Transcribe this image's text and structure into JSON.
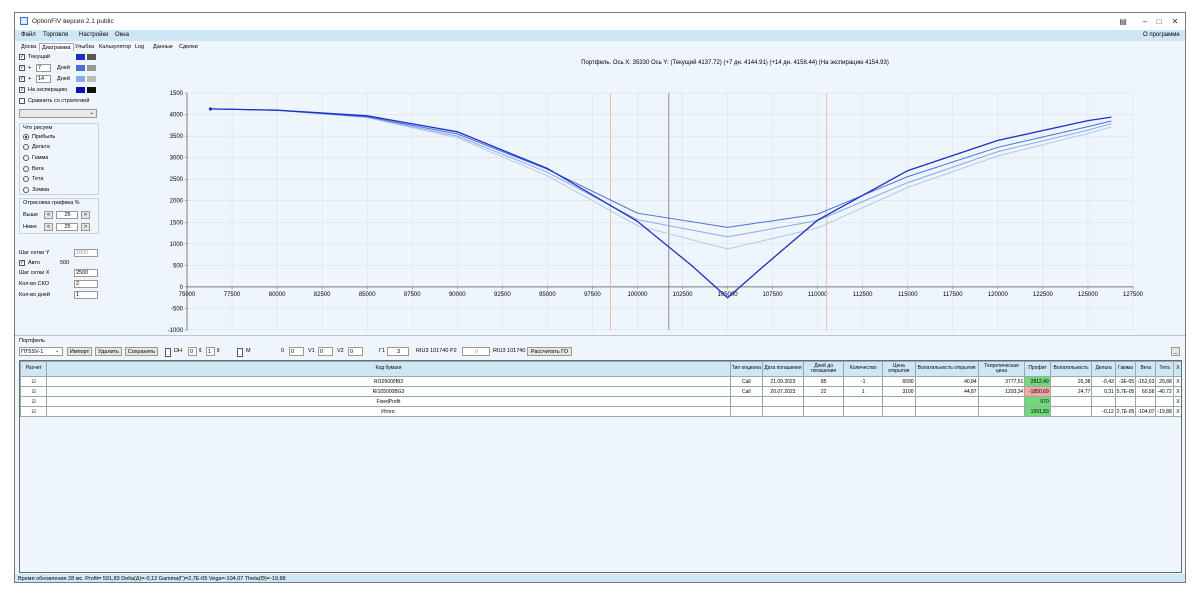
{
  "window": {
    "title": "OptionFIV версия 2.1 public",
    "help_label": "О программе"
  },
  "menu": [
    "Файл",
    "Торговля",
    "Настройки",
    "Окна"
  ],
  "tabs": [
    "Доска",
    "Диаграмма",
    "Улыбка",
    "Калькулятор",
    "Log",
    "Данные",
    "Сделки"
  ],
  "left": {
    "current_label": "Текущий",
    "plus1_value": "7",
    "plus1_suffix": "Дней",
    "plus2_value": "14",
    "plus2_suffix": "Дней",
    "expiry_label": "На экспирацию",
    "compare_label": "Сравнить со стратегией",
    "what_label": "Что рисуем",
    "radio_options": [
      "Прибыль",
      "Дельта",
      "Гамма",
      "Вега",
      "Тета",
      "Зомма"
    ],
    "range_label": "Отрисовка графика %",
    "above_label": "Выше",
    "above_value": "25",
    "below_label": "Ниже",
    "below_value": "25",
    "grid_y_label": "Шаг сетки Y",
    "grid_y_value": "1000",
    "auto_label": "Авто",
    "auto_value": "500",
    "grid_x_label": "Шаг сетки X",
    "grid_x_value": "2500",
    "sko_label": "Кол-во СКО",
    "sko_value": "2",
    "days_label": "Кол-во дней",
    "days_value": "1",
    "minus_sym": "<",
    "plus_sym": ">"
  },
  "chart_data": {
    "type": "line",
    "title": "Портфель. Ось X: 35330 Ось Y: (Текущий 4137.72) (+7 дн. 4144.91) (+14 дн. 4158.44) (На экспирацию 4154.93)",
    "xlim": [
      75000,
      127500
    ],
    "ylim": [
      -1000,
      1500
    ],
    "x_ticks": [
      "75000",
      "77500",
      "80000",
      "82500",
      "85000",
      "87500",
      "90000",
      "92500",
      "95000",
      "97500",
      "100000",
      "102500",
      "105000",
      "107500",
      "110000",
      "112500",
      "115000",
      "117500",
      "120000",
      "122500",
      "125000",
      "127500"
    ],
    "y_ticks": [
      "1500",
      "4000",
      "3500",
      "3000",
      "2500",
      "2000",
      "1500",
      "1000",
      "500",
      "0",
      "-500",
      "-1000"
    ],
    "current_x_line": 101740,
    "strike_lines": [
      98500,
      110500
    ],
    "series": [
      {
        "color": "#1c2fc8",
        "x": [
          76300,
          80000,
          85000,
          90000,
          95000,
          100000,
          103000,
          105000,
          107000,
          110000,
          115000,
          120000,
          125000,
          126300
        ],
        "y": [
          4130,
          4100,
          3970,
          3600,
          2750,
          1520,
          500,
          -250,
          480,
          1550,
          2700,
          3400,
          3860,
          3940
        ]
      },
      {
        "color": "#4a6fd8",
        "x": [
          76300,
          80000,
          85000,
          90000,
          95000,
          100000,
          105000,
          110000,
          115000,
          120000,
          125000,
          126300
        ],
        "y": [
          4130,
          4100,
          3950,
          3550,
          2730,
          1710,
          1380,
          1690,
          2560,
          3240,
          3720,
          3850
        ]
      },
      {
        "color": "#8aa9e8",
        "x": [
          76300,
          80000,
          85000,
          90000,
          95000,
          100000,
          105000,
          110000,
          115000,
          120000,
          125000,
          126300
        ],
        "y": [
          4130,
          4100,
          3940,
          3500,
          2660,
          1560,
          1160,
          1540,
          2420,
          3140,
          3640,
          3790
        ]
      },
      {
        "color": "#b3c8ef",
        "x": [
          76300,
          80000,
          85000,
          90000,
          95000,
          100000,
          105000,
          110000,
          115000,
          120000,
          125000,
          126300
        ],
        "y": [
          4130,
          4100,
          3930,
          3460,
          2580,
          1420,
          880,
          1370,
          2310,
          3040,
          3560,
          3710
        ]
      }
    ]
  },
  "portfolio": {
    "label": "Портфель",
    "select_value": "ПТ5SV-1",
    "import_label": "Импорт",
    "delete_label": "Удалить",
    "save_label": "Сохранить",
    "dh_label": "DH",
    "dh_v1": "0",
    "dh_v2": "1",
    "m_label": "M",
    "zero_label": "0",
    "v1_label": "V1",
    "v1_value": "0",
    "v2_label": "V2",
    "v2_value": "0",
    "g1_label": "Г1",
    "g1_value": "3",
    "riu_label": "RIU3 101740",
    "p2_label": "P2",
    "p2_value": "0",
    "riu2_label": "RIU3 101740",
    "calc_label": "Рассчитать ГО",
    "min_btn": "_"
  },
  "table": {
    "headers": [
      "Расчет",
      "Код бумаги",
      "Тип опциона",
      "Дата погашения",
      "Дней до погашения",
      "Количество",
      "Цена открытия",
      "Волатильность открытия",
      "Теоретическая цена",
      "Профит",
      "Волатильность",
      "Дельта",
      "Гамма",
      "Вега",
      "Тета",
      "X"
    ],
    "rows": [
      {
        "check": "☑",
        "code": "RI105000BI3",
        "type": "Call",
        "date": "21.09.2023",
        "days": "85",
        "qty": "-1",
        "price": "6590",
        "vol_open": "40,84",
        "theo": "3777,51",
        "profit": "2812,49",
        "profit_cls": "green",
        "vol": "26,38",
        "delta": "-0,43",
        "gamma": "-3E-05",
        "vega": "-152,63",
        "theta": "29,88",
        "x": "X"
      },
      {
        "check": "☑",
        "code": "RI105000BG3",
        "type": "Call",
        "date": "20.07.2023",
        "days": "22",
        "qty": "1",
        "price": "3100",
        "vol_open": "44,87",
        "theo": "1293,34",
        "profit": "-1850,69",
        "profit_cls": "red",
        "vol": "24,77",
        "delta": "0,31",
        "gamma": "5,7E-05",
        "vega": "60,56",
        "theta": "-40,72",
        "x": "X"
      },
      {
        "check": "☑",
        "code": "FixedProfit",
        "type": "",
        "date": "",
        "days": "",
        "qty": "",
        "price": "",
        "vol_open": "",
        "theo": "",
        "profit": "570",
        "profit_cls": "green",
        "vol": "",
        "delta": "",
        "gamma": "",
        "vega": "",
        "theta": "",
        "x": "X"
      },
      {
        "check": "☑",
        "code": "Итого:",
        "type": "",
        "date": "",
        "days": "",
        "qty": "",
        "price": "",
        "vol_open": "",
        "theo": "",
        "profit": "1591,83",
        "profit_cls": "green",
        "vol": "",
        "delta": "-0,12",
        "gamma": "2,7E-05",
        "vega": "-104,07",
        "theta": "-19,88",
        "x": "X"
      }
    ]
  },
  "status": "Время обновления 28 мс. Profit= 591,83 Delta(Δ)=-0,12 Gamma(Γ)=2,7E-05 Vega=-104,07 Theta(Θ)=-19,88"
}
